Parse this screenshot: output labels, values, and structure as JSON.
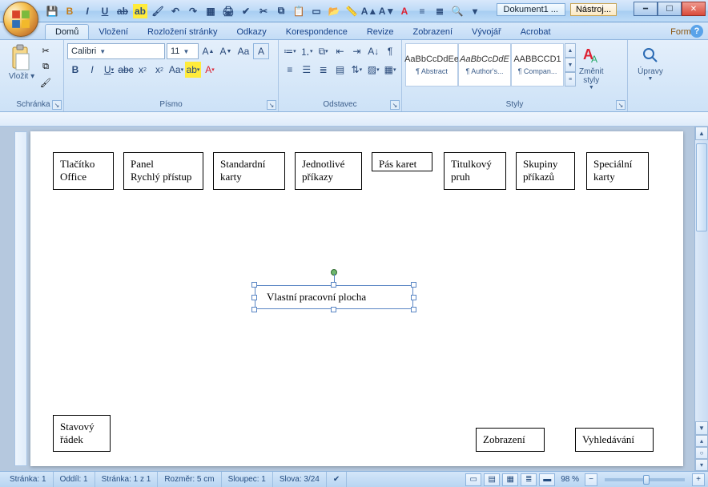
{
  "title": {
    "document": "Dokument1 ...",
    "context_tab_label": "Nástroj..."
  },
  "qat_icons": [
    "save",
    "bold",
    "italic",
    "underline",
    "highlight",
    "brush",
    "undo",
    "redo",
    "table",
    "print",
    "spell",
    "cut",
    "copy",
    "paste",
    "new",
    "open",
    "ruler",
    "font-grow",
    "font-shrink",
    "font-color",
    "align",
    "list",
    "zoom",
    "find",
    "more"
  ],
  "tabs": {
    "items": [
      "Domů",
      "Vložení",
      "Rozložení stránky",
      "Odkazy",
      "Korespondence",
      "Revize",
      "Zobrazení",
      "Vývojář",
      "Acrobat"
    ],
    "context": "Formát",
    "active_index": 0
  },
  "ribbon": {
    "clipboard": {
      "paste": "Vložit",
      "label": "Schránka"
    },
    "font": {
      "name": "Calibri",
      "size": "11",
      "label": "Písmo"
    },
    "para": {
      "label": "Odstavec"
    },
    "styles": {
      "label": "Styly",
      "items": [
        {
          "preview": "AaBbCcDdEe",
          "name": "¶ Abstract"
        },
        {
          "preview": "AaBbCcDdE",
          "name": "¶ Author's..."
        },
        {
          "preview": "AABBCCD1",
          "name": "¶ Compan..."
        }
      ],
      "change": "Změnit\nstyly"
    },
    "editing": {
      "label": "Úpravy"
    }
  },
  "doc_boxes": {
    "top": [
      "Tlačítko\nOffice",
      "Panel\nRychlý přístup",
      "Standardní\nkarty",
      "Jednotlivé\npříkazy",
      "Pás karet",
      "Titulkový\npruh",
      "Skupiny\npříkazů",
      "Speciální\nkarty"
    ],
    "center": "Vlastní pracovní plocha",
    "bottom": [
      "Stavový\nřádek",
      "Zobrazení",
      "Vyhledávání"
    ]
  },
  "status": {
    "page": "Stránka: 1",
    "section": "Oddíl: 1",
    "pages": "Stránka: 1 z 1",
    "pos": "Rozměr: 5 cm",
    "col": "Sloupec: 1",
    "words": "Slova: 3/24",
    "zoom": "98 %"
  }
}
